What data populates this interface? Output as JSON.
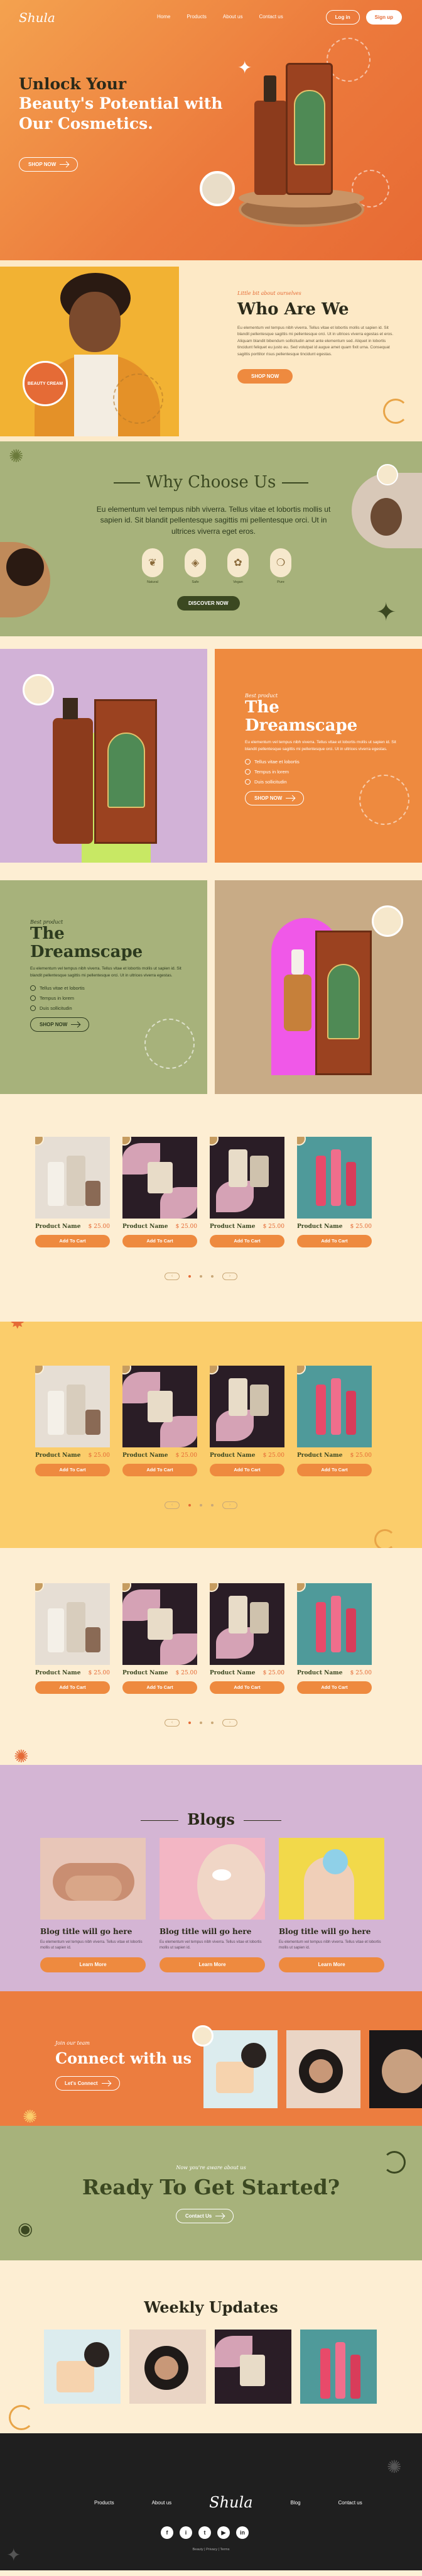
{
  "brand": {
    "logo": "Shula"
  },
  "nav": {
    "links": [
      "Home",
      "Products",
      "About us",
      "Contact us"
    ],
    "login": "Log in",
    "signup": "Sign up"
  },
  "hero": {
    "title_line1": "Unlock Your",
    "title_line2": "Beauty's Potential with",
    "title_line3": "Our Cosmetics.",
    "cta": "SHOP NOW"
  },
  "who": {
    "kicker": "Little bit about ourselves",
    "title": "Who Are We",
    "para": "Eu elementum vel tempus nibh viverra. Tellus vitae et lobortis mollis ut sapien id. Sit blandit pellentesque sagittis mi pellentesque orci. Ut in ultrices viverra egestas et eros. Aliquam blandit bibendum sollicitudin amet ante elementum sed. Aliquet in lobortis tincidunt feliquet eu justo eu. Sed volutpat id augue amet quam fixit urna. Consequat sagittis porttitor risus pellentesque tincidunt egestas.",
    "cta": "SHOP NOW",
    "badge": "BEAUTY CREAM"
  },
  "why": {
    "title": "Why Choose Us",
    "para": "Eu elementum vel tempus nibh viverra. Tellus vitae et lobortis mollis ut sapien id. Sit blandit pellentesque sagittis mi pellentesque orci. Ut in ultrices viverra eget eros.",
    "features": [
      {
        "icon": "leaf-icon",
        "glyph": "❦",
        "label": "Natural"
      },
      {
        "icon": "shield-icon",
        "glyph": "◈",
        "label": "Safe"
      },
      {
        "icon": "flower-icon",
        "glyph": "✿",
        "label": "Vegan"
      },
      {
        "icon": "drop-icon",
        "glyph": "❍",
        "label": "Pure"
      }
    ],
    "cta": "DISCOVER NOW"
  },
  "feature1": {
    "kicker": "Best product",
    "title": "The Dreamscape",
    "para": "Eu elementum vel tempus nibh viverra. Tellus vitae et lobortis mollis ut sapien id. Sit blandit pellentesque sagittis mi pellentesque orci. Ut in ultrices viverra egestas.",
    "bullets": [
      "Tellus vitae et lobortis",
      "Tempus in lorem",
      "Duis sollicitudin"
    ],
    "cta": "SHOP NOW"
  },
  "feature2": {
    "kicker": "Best product",
    "title": "The Dreamscape",
    "para": "Eu elementum vel tempus nibh viverra. Tellus vitae et lobortis mollis ut sapien id. Sit blandit pellentesque sagittis mi pellentesque orci. Ut in ultrices viverra egestas.",
    "bullets": [
      "Tellus vitae et lobortis",
      "Tempus in lorem",
      "Duis sollicitudin"
    ],
    "cta": "SHOP NOW"
  },
  "product_grid": {
    "name": "Product Name",
    "price": "$ 25.00",
    "add": "Add To Cart",
    "prev": "‹",
    "next": "›"
  },
  "blogs": {
    "title": "Blogs",
    "items": [
      {
        "title": "Blog title will go here",
        "para": "Eu elementum vel tempus nibh viverra. Tellus vitae et lobortis mollis ut sapien id.",
        "cta": "Learn More"
      },
      {
        "title": "Blog title will go here",
        "para": "Eu elementum vel tempus nibh viverra. Tellus vitae et lobortis mollis ut sapien id.",
        "cta": "Learn More"
      },
      {
        "title": "Blog title will go here",
        "para": "Eu elementum vel tempus nibh viverra. Tellus vitae et lobortis mollis ut sapien id.",
        "cta": "Learn More"
      }
    ]
  },
  "connect": {
    "kicker": "Join our team",
    "title": "Connect with us",
    "cta": "Let's Connect"
  },
  "start": {
    "kicker": "Now you're aware about us",
    "title": "Ready To Get Started?",
    "cta": "Contact Us"
  },
  "weekly": {
    "title": "Weekly Updates"
  },
  "footer": {
    "links": [
      "Products",
      "About us",
      "Blog",
      "Contact us"
    ],
    "socials": [
      "f",
      "i",
      "t",
      "▶",
      "in"
    ],
    "copyright": "Beauty | Privacy | Terms"
  },
  "colors": {
    "orange": "#ec7a3c",
    "olive": "#a7b27b",
    "cream": "#fdeed3",
    "dark_green": "#3b4821"
  }
}
